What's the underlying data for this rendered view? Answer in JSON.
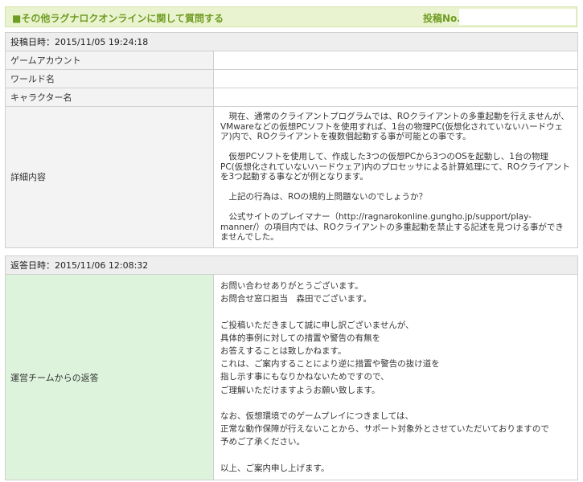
{
  "header": {
    "title": "■その他ラグナロクオンラインに関して質問する",
    "post_no_label": "投稿No."
  },
  "question": {
    "posted_at": "投稿日時：2015/11/05 19:24:18",
    "fields": [
      {
        "label": "ゲームアカウント",
        "value": ""
      },
      {
        "label": "ワールド名",
        "value": ""
      },
      {
        "label": "キャラクター名",
        "value": ""
      }
    ],
    "detail_label": "詳細内容",
    "detail_paragraphs": [
      "　現在、通常のクライアントプログラムでは、ROクライアントの多重起動を行えませんが、VMwareなどの仮想PCソフトを使用すれば、1台の物理PC(仮想化されていないハードウェア)内で、ROクライアントを複数個起動する事が可能との事です。",
      "　仮想PCソフトを使用して、作成した3つの仮想PCから3つのOSを起動し、1台の物理PC(仮想化されていないハードウェア)内のプロセッサによる計算処理にて、ROクライアントを3つ起動する事などが例となります。",
      "　上記の行為は、ROの規約上問題ないのでしょうか？",
      "　公式サイトのプレイマナー（http://ragnarokonline.gungho.jp/support/play-manner/）の項目内では、ROクライアントの多重起動を禁止する記述を見つける事ができませんでした。"
    ]
  },
  "reply": {
    "replied_at": "返答日時：2015/11/06 12:08:32",
    "label": "運営チームからの返答",
    "lines": [
      "お問い合わせありがとうございます。",
      "お問合せ窓口担当　森田でございます。",
      "",
      "ご投稿いただきまして誠に申し訳ございませんが、",
      "具体的事例に対しての措置や警告の有無を",
      "お答えすることは致しかねます。",
      "これは、ご案内することにより逆に措置や警告の抜け道を",
      "指し示す事にもなりかねないためですので、",
      "ご理解いただけますようお願い致します。",
      "",
      "なお、仮想環境でのゲームプレイにつきましては、",
      "正常な動作保障が行えないことから、サポート対象外とさせていただいておりますので",
      "予めご了承ください。",
      "",
      "以上、ご案内申し上げます。"
    ]
  },
  "colors": {
    "accent_green": "#6f9c22",
    "header_bg": "#eaf3cf",
    "reply_label_bg": "#ddf3dc"
  }
}
